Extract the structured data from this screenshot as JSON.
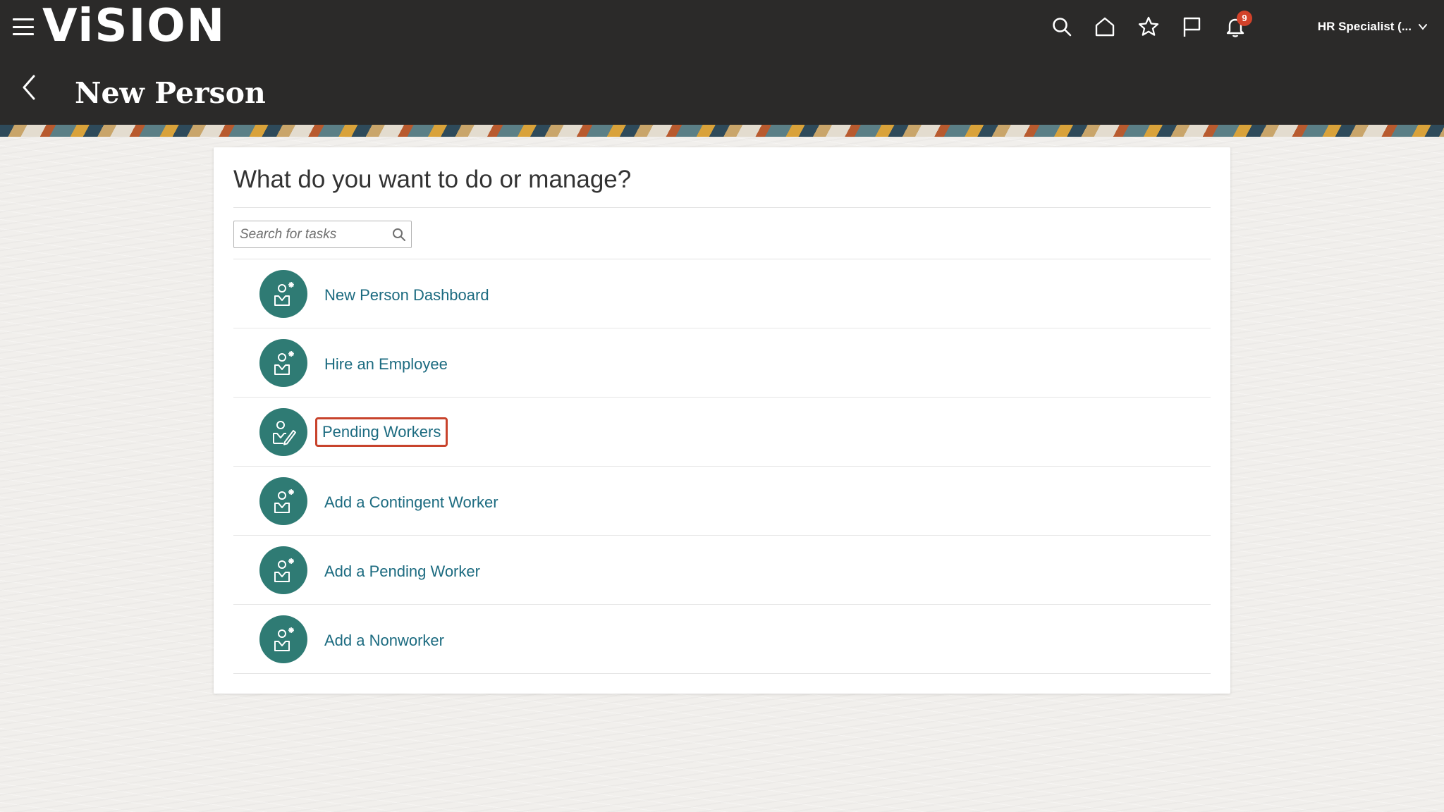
{
  "header": {
    "logo": "ViSION",
    "notifications_count": "9",
    "user_role": "HR Specialist (...",
    "icons": [
      "menu-icon",
      "search-icon",
      "home-icon",
      "star-icon",
      "flag-icon",
      "bell-icon",
      "chevron-down-icon"
    ]
  },
  "page": {
    "title": "New Person"
  },
  "panel": {
    "question": "What do you want to do or manage?",
    "search": {
      "placeholder": "Search for tasks",
      "value": ""
    },
    "tasks": [
      {
        "label": "New Person Dashboard",
        "icon": "person-add-icon"
      },
      {
        "label": "Hire an Employee",
        "icon": "person-add-icon"
      },
      {
        "label": "Pending Workers",
        "icon": "person-edit-icon",
        "highlighted": true
      },
      {
        "label": "Add a Contingent Worker",
        "icon": "person-add-icon"
      },
      {
        "label": "Add a Pending Worker",
        "icon": "person-add-icon"
      },
      {
        "label": "Add a Nonworker",
        "icon": "person-add-icon"
      }
    ]
  },
  "colors": {
    "header_bg": "#2b2a29",
    "task_icon_bg": "#2f7b74",
    "link": "#1c6b80",
    "highlight_border": "#c8432c",
    "badge": "#d2422a"
  }
}
